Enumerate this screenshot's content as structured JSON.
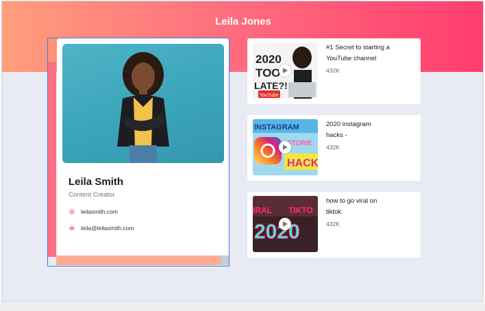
{
  "banner": {
    "title": "Leila Jones"
  },
  "profile": {
    "name": "Leila Smith",
    "role": "Content Creator",
    "website": "leilasmith.com",
    "email": "leila@leilasmith.com"
  },
  "videos": [
    {
      "title": "#1 Secret to starting a YouTube channel",
      "views": "432K",
      "thumb_text": [
        "2020",
        "TOO",
        "LATE?!",
        "YouTube"
      ]
    },
    {
      "title": "2020 instagram hacks -",
      "views": "432K",
      "thumb_text": [
        "INSTAGRAM",
        "STORIE",
        "HACK"
      ]
    },
    {
      "title": "how to go viral on tiktok",
      "views": "432K",
      "thumb_text": [
        "IRAL",
        "TIKTO",
        "2020"
      ]
    }
  ],
  "colors": {
    "banner_start": "#ff9e7a",
    "banner_end": "#ff3d6e",
    "background": "#e8ebf3",
    "accent": "#ff6f84"
  },
  "icons": {
    "website": "globe-icon",
    "email": "mail-icon",
    "play": "play-icon"
  }
}
